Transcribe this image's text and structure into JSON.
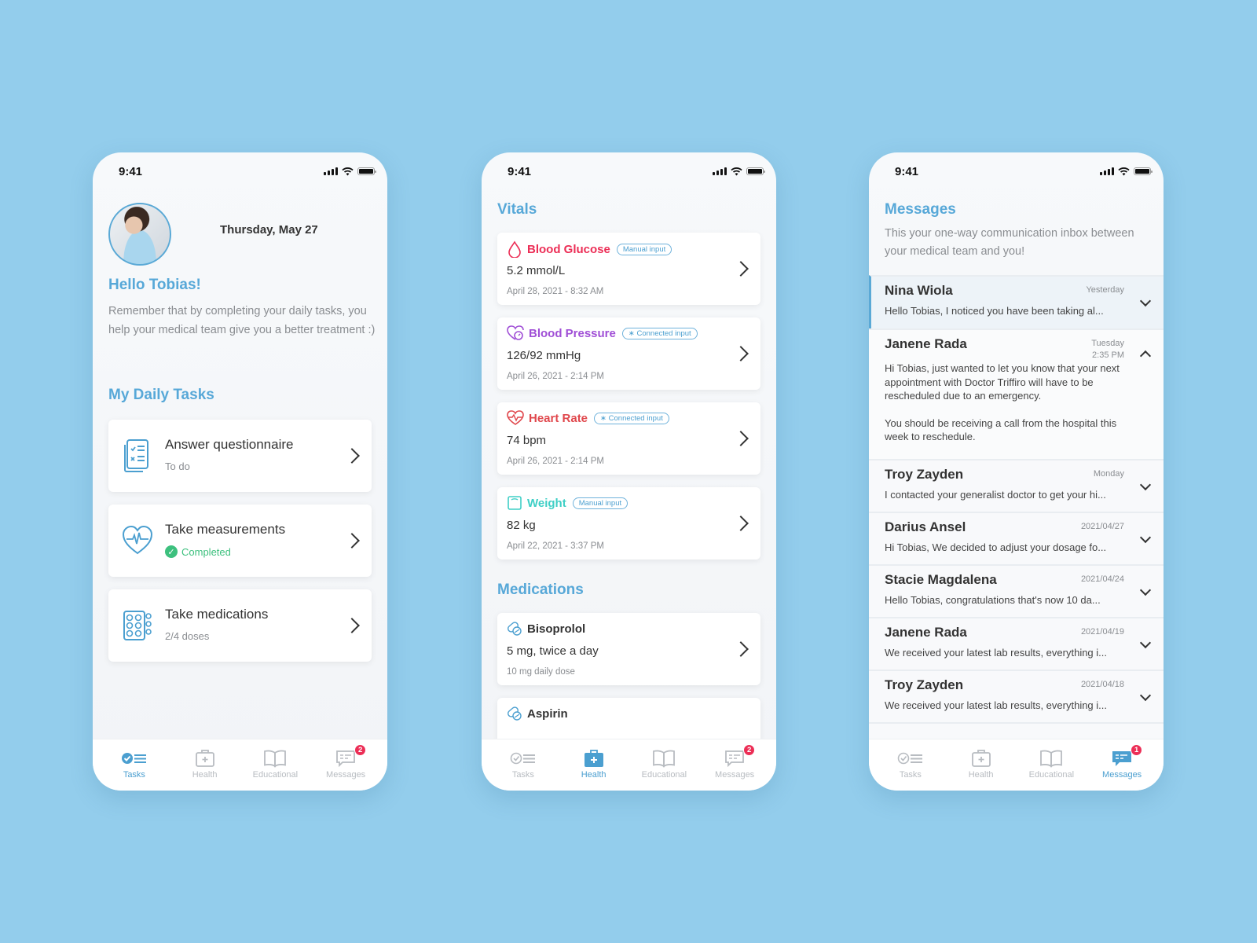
{
  "status_bar": {
    "time": "9:41"
  },
  "colors": {
    "background": "#93cdec",
    "accent": "#57a8d8",
    "blood_glucose": "#ec2e56",
    "blood_pressure": "#a04fd6",
    "heart_rate": "#e0474c",
    "weight": "#3fcfc6",
    "completed": "#3dc07e",
    "badge": "#ec2e56"
  },
  "tabbar": {
    "tabs": [
      {
        "label": "Tasks",
        "icon": "tasks-icon"
      },
      {
        "label": "Health",
        "icon": "medkit-icon"
      },
      {
        "label": "Educational",
        "icon": "book-icon"
      },
      {
        "label": "Messages",
        "icon": "chat-icon"
      }
    ]
  },
  "tasks_screen": {
    "date": "Thursday, May 27",
    "greeting": "Hello Tobias!",
    "intro": "Remember that by completing your daily tasks, you help your medical team give you a better treatment :)",
    "section_title": "My Daily Tasks",
    "tasks": [
      {
        "title": "Answer questionnaire",
        "status": "To do",
        "icon": "questionnaire-icon"
      },
      {
        "title": "Take measurements",
        "status": "Completed",
        "icon": "heart-pulse-icon"
      },
      {
        "title": "Take medications",
        "status": "2/4 doses",
        "icon": "pill-pack-icon"
      }
    ],
    "messages_badge": "2"
  },
  "health_screen": {
    "vitals_title": "Vitals",
    "vitals": [
      {
        "name": "Blood Glucose",
        "tag": "Manual input",
        "value": "5.2 mmol/L",
        "date": "April 28, 2021 - 8:32 AM",
        "icon": "blood-drop-icon"
      },
      {
        "name": "Blood Pressure",
        "tag": "Connected input",
        "value": "126/92 mmHg",
        "date": "April 26, 2021 - 2:14 PM",
        "icon": "heart-gauge-icon"
      },
      {
        "name": "Heart Rate",
        "tag": "Connected input",
        "value": "74 bpm",
        "date": "April 26, 2021 - 2:14 PM",
        "icon": "heart-rate-icon"
      },
      {
        "name": "Weight",
        "tag": "Manual input",
        "value": "82 kg",
        "date": "April 22, 2021 - 3:37 PM",
        "icon": "scale-icon"
      }
    ],
    "medications_title": "Medications",
    "medications": [
      {
        "name": "Bisoprolol",
        "dose": "5 mg, twice a day",
        "daily": "10 mg daily dose"
      },
      {
        "name": "Aspirin"
      }
    ],
    "messages_badge": "2"
  },
  "messages_screen": {
    "title": "Messages",
    "description": "This your one-way communication inbox between your medical team and you!",
    "messages": [
      {
        "sender": "Nina Wiola",
        "date": "Yesterday",
        "preview": "Hello Tobias, I noticed you have been taking al..."
      },
      {
        "sender": "Janene Rada",
        "date": "Tuesday",
        "time": "2:35 PM",
        "body": [
          "Hi Tobias, just wanted to let you know that your next appointment with Doctor Triffiro will have to be rescheduled due to an emergency.",
          "You should be receiving a call from the hospital this week to reschedule."
        ]
      },
      {
        "sender": "Troy Zayden",
        "date": "Monday",
        "preview": "I contacted your generalist doctor to get your hi..."
      },
      {
        "sender": "Darius Ansel",
        "date": "2021/04/27",
        "preview": "Hi Tobias, We decided to adjust your dosage fo..."
      },
      {
        "sender": "Stacie Magdalena",
        "date": "2021/04/24",
        "preview": "Hello Tobias, congratulations that's now 10 da..."
      },
      {
        "sender": "Janene Rada",
        "date": "2021/04/19",
        "preview": "We received your latest lab results, everything i..."
      },
      {
        "sender": "Troy Zayden",
        "date": "2021/04/18",
        "preview": "We received your latest lab results, everything i..."
      }
    ],
    "messages_badge": "1"
  }
}
